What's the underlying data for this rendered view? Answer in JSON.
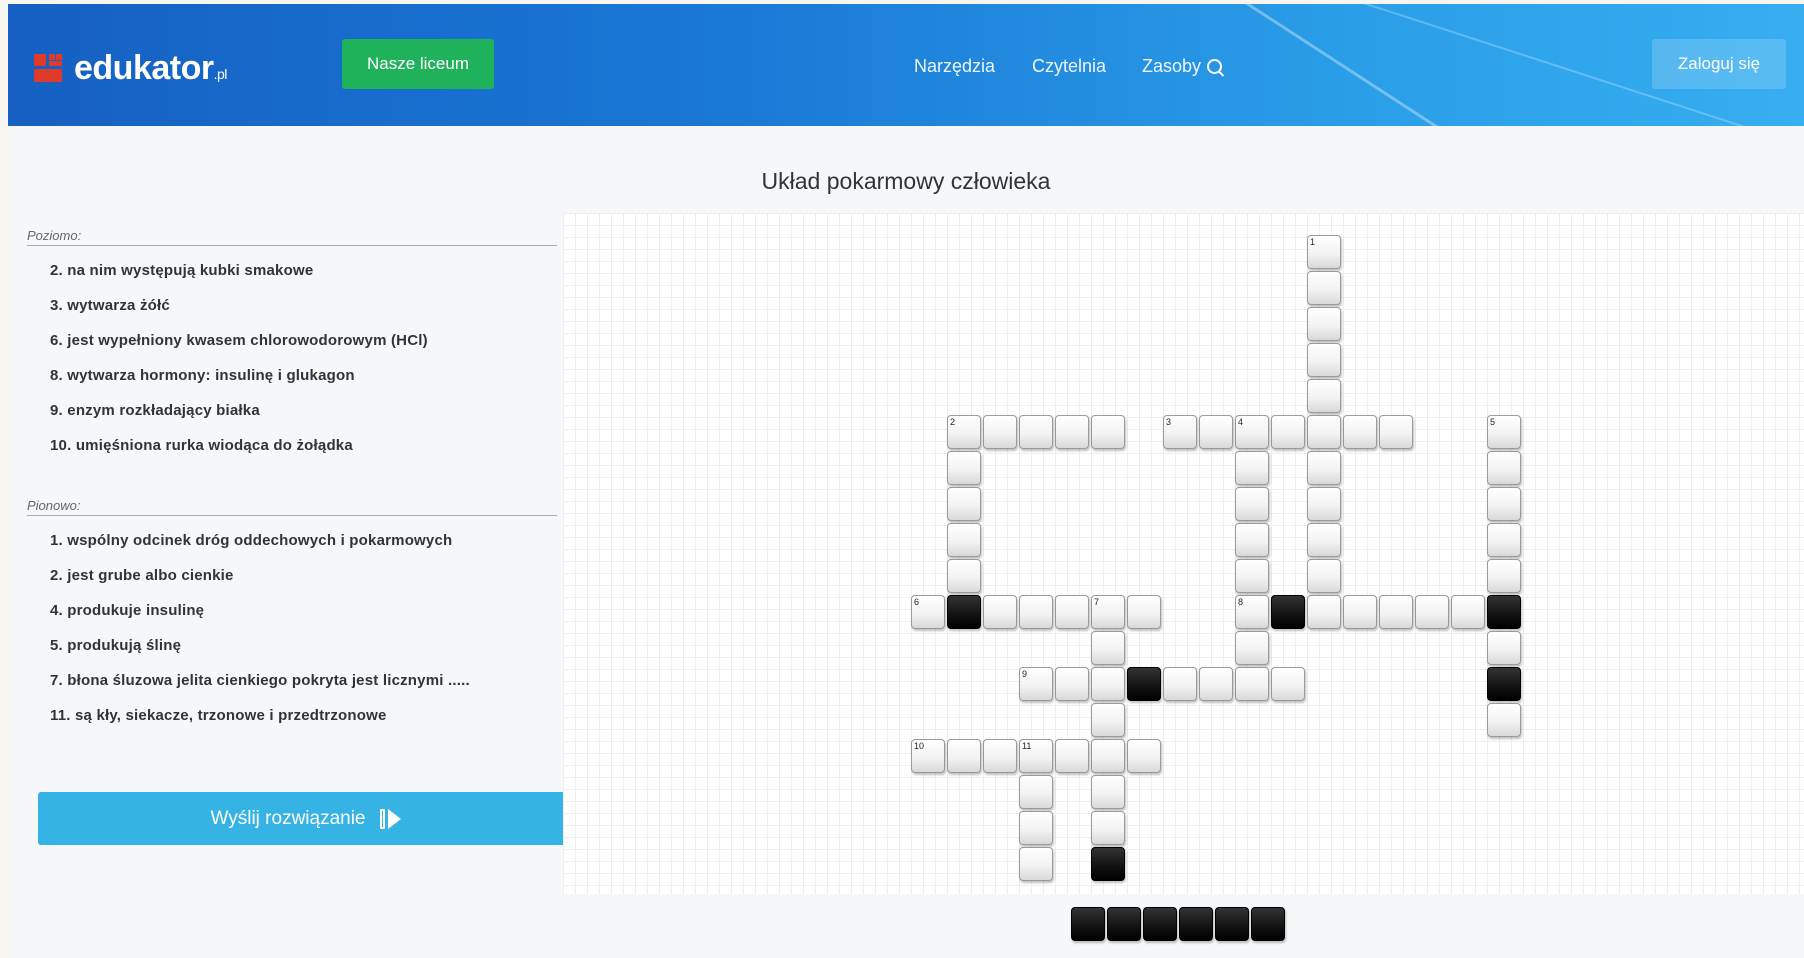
{
  "header": {
    "logo_text": "edukator",
    "logo_suffix": ".pl",
    "school_button": "Nasze liceum",
    "nav": [
      "Narzędzia",
      "Czytelnia",
      "Zasoby"
    ],
    "login_button": "Zaloguj się",
    "search_icon": "search-icon"
  },
  "page_title": "Układ pokarmowy człowieka",
  "clues": {
    "across_heading": "Poziomo:",
    "across": [
      "2. na nim występują kubki smakowe",
      "3. wytwarza żółć",
      "6. jest wypełniony kwasem chlorowodorowym (HCl)",
      "8. wytwarza hormony: insulinę i glukagon",
      "9. enzym rozkładający białka",
      "10. umięśniona rurka wiodąca do żołądka"
    ],
    "down_heading": "Pionowo:",
    "down": [
      "1. wspólny odcinek dróg oddechowych i pokarmowych",
      "2. jest grube albo cienkie",
      "4. produkuje insulinę",
      "5. produkują ślinę",
      "7. błona śluzowa jelita cienkiego pokryta jest licznymi .....",
      "11. są kły, siekacze, trzonowe i przedtrzonowe"
    ]
  },
  "send_button": "Wyślij rozwiązanie",
  "colors": {
    "header_start": "#1560c2",
    "header_end": "#36aef0",
    "school_button": "#1fb25a",
    "send_button": "#35b3e5"
  },
  "crossword": {
    "numbers": [
      "1",
      "2",
      "3",
      "4",
      "5",
      "6",
      "7",
      "8",
      "9",
      "10",
      "11"
    ],
    "solution_length": 6
  }
}
